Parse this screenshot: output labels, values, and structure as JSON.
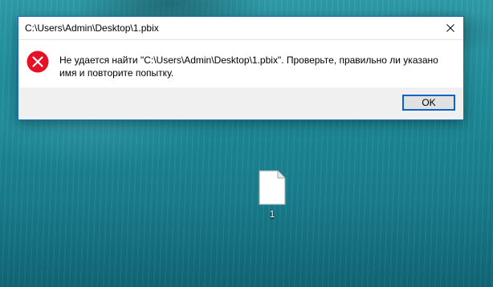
{
  "dialog": {
    "title": "C:\\Users\\Admin\\Desktop\\1.pbix",
    "message": "Не удается найти \"C:\\Users\\Admin\\Desktop\\1.pbix\". Проверьте, правильно ли указано имя и повторите попытку.",
    "ok_label": "OK",
    "close_icon": "close-icon",
    "status_icon": "error-icon"
  },
  "desktop": {
    "file_label": "1",
    "file_icon": "blank-file-icon"
  },
  "colors": {
    "accent": "#0a62c9",
    "error_red": "#e81123",
    "desktop_teal": "#1f8b99"
  }
}
